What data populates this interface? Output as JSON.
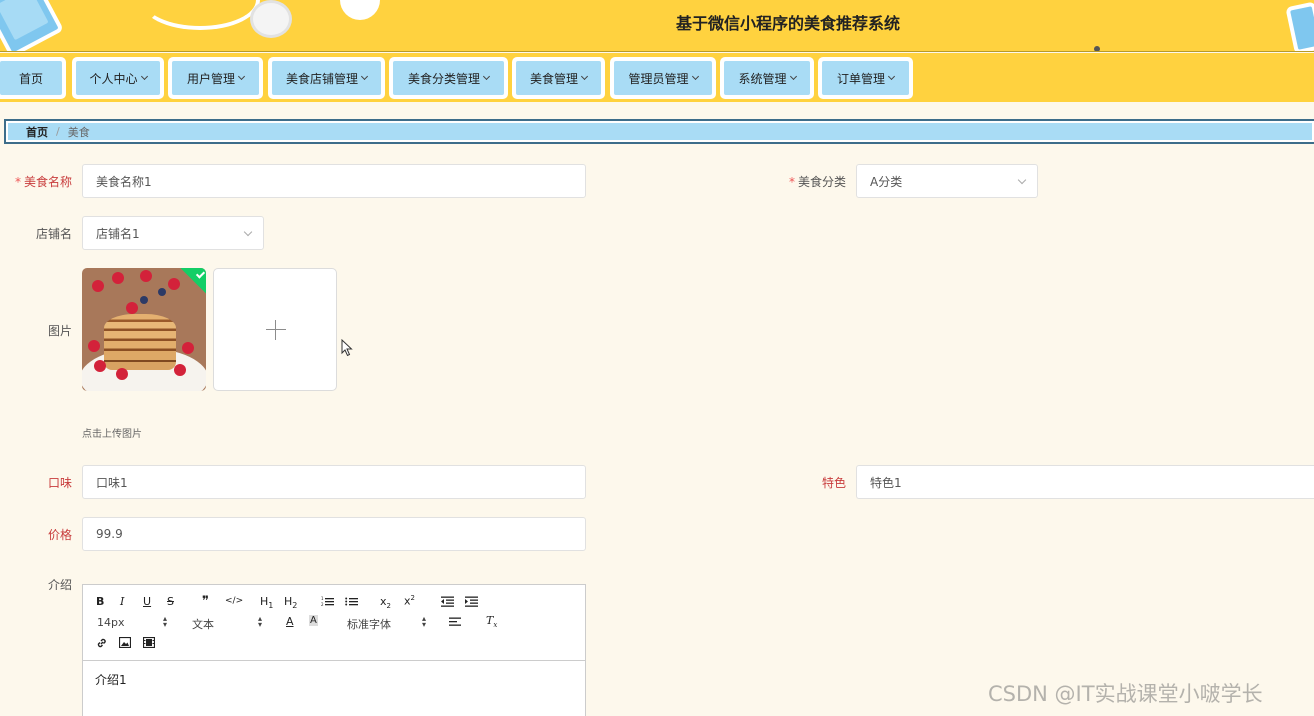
{
  "header": {
    "title": "基于微信小程序的美食推荐系统"
  },
  "nav": {
    "items": [
      {
        "label": "首页",
        "has_dropdown": false
      },
      {
        "label": "个人中心",
        "has_dropdown": true
      },
      {
        "label": "用户管理",
        "has_dropdown": true
      },
      {
        "label": "美食店铺管理",
        "has_dropdown": true
      },
      {
        "label": "美食分类管理",
        "has_dropdown": true
      },
      {
        "label": "美食管理",
        "has_dropdown": true
      },
      {
        "label": "管理员管理",
        "has_dropdown": true
      },
      {
        "label": "系统管理",
        "has_dropdown": true
      },
      {
        "label": "订单管理",
        "has_dropdown": true
      }
    ]
  },
  "breadcrumb": {
    "home": "首页",
    "separator": "/",
    "current": "美食"
  },
  "form": {
    "food_name": {
      "label": "美食名称",
      "value": "美食名称1",
      "required": true
    },
    "food_category": {
      "label": "美食分类",
      "value": "A分类",
      "required": true
    },
    "shop_name": {
      "label": "店铺名",
      "value": "店铺名1"
    },
    "image": {
      "label": "图片",
      "hint": "点击上传图片",
      "upload_icon": "plus-icon"
    },
    "taste": {
      "label": "口味",
      "value": "口味1"
    },
    "feature": {
      "label": "特色",
      "value": "特色1"
    },
    "price": {
      "label": "价格",
      "value": "99.9"
    },
    "intro": {
      "label": "介绍",
      "content": "介绍1"
    }
  },
  "editor_toolbar": {
    "row1": [
      "B",
      "I",
      "U",
      "S",
      "❞",
      "</>",
      "H1",
      "H2",
      "ol",
      "ul",
      "x₂",
      "x²",
      "outdent",
      "indent"
    ],
    "font_size": "14px",
    "text_type": "文本",
    "font_family": "标准字体",
    "row2_icons": [
      "font-color-icon",
      "background-color-icon",
      "align-icon",
      "clear-format-icon"
    ],
    "row3_icons": [
      "link-icon",
      "image-icon",
      "video-icon"
    ]
  },
  "watermark": "CSDN @IT实战课堂小啵学长",
  "colors": {
    "header_bg": "#ffd23f",
    "nav_tab_bg": "#a9dcf5",
    "page_bg": "#fdf8ec",
    "required": "#e55555",
    "success": "#13ce66"
  }
}
